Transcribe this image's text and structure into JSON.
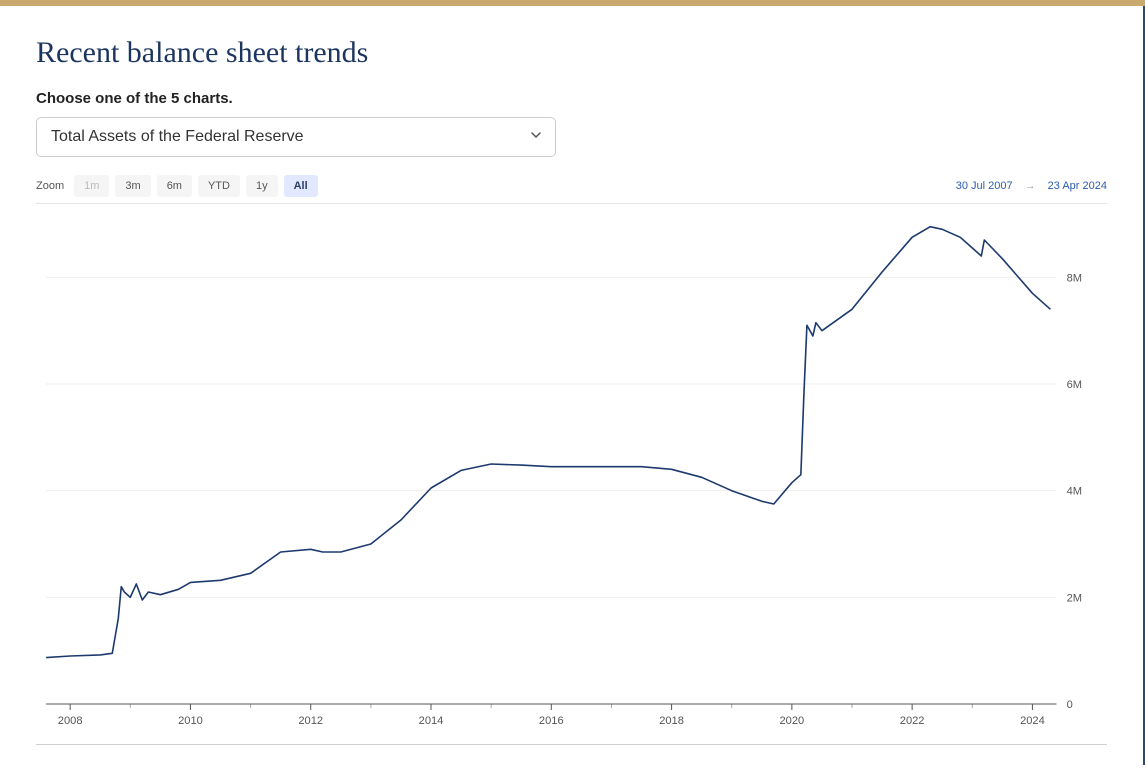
{
  "header": {
    "title": "Recent balance sheet trends",
    "prompt": "Choose one of the 5 charts."
  },
  "selector": {
    "value": "Total Assets of the Federal Reserve"
  },
  "zoom": {
    "label": "Zoom",
    "buttons": [
      "1m",
      "3m",
      "6m",
      "YTD",
      "1y",
      "All"
    ],
    "disabled": [
      "1m"
    ],
    "active": "All"
  },
  "range": {
    "from": "30 Jul 2007",
    "to": "23 Apr 2024",
    "arrow": "→"
  },
  "chart_data": {
    "type": "line",
    "x": [
      2007.6,
      2008.0,
      2008.5,
      2008.7,
      2008.8,
      2008.85,
      2008.9,
      2009.0,
      2009.1,
      2009.2,
      2009.3,
      2009.5,
      2009.8,
      2010.0,
      2010.5,
      2011.0,
      2011.5,
      2012.0,
      2012.2,
      2012.5,
      2013.0,
      2013.5,
      2014.0,
      2014.5,
      2015.0,
      2015.5,
      2016.0,
      2016.5,
      2017.0,
      2017.5,
      2018.0,
      2018.5,
      2019.0,
      2019.5,
      2019.7,
      2020.0,
      2020.15,
      2020.2,
      2020.25,
      2020.35,
      2020.4,
      2020.5,
      2021.0,
      2021.5,
      2022.0,
      2022.3,
      2022.5,
      2022.8,
      2023.0,
      2023.15,
      2023.2,
      2023.5,
      2024.0,
      2024.3
    ],
    "values": [
      870000,
      900000,
      920000,
      950000,
      1600000,
      2200000,
      2100000,
      2000000,
      2250000,
      1950000,
      2100000,
      2050000,
      2150000,
      2280000,
      2320000,
      2450000,
      2850000,
      2900000,
      2850000,
      2850000,
      3000000,
      3450000,
      4050000,
      4380000,
      4500000,
      4480000,
      4450000,
      4450000,
      4450000,
      4450000,
      4400000,
      4250000,
      4000000,
      3800000,
      3750000,
      4150000,
      4300000,
      5800000,
      7100000,
      6900000,
      7150000,
      7000000,
      7400000,
      8100000,
      8750000,
      8950000,
      8900000,
      8750000,
      8550000,
      8400000,
      8700000,
      8350000,
      7700000,
      7400000
    ],
    "xlabel": "",
    "ylabel": "",
    "xlim": [
      2007.6,
      2024.4
    ],
    "ylim": [
      0,
      9000000
    ],
    "yticks": [
      0,
      2000000,
      4000000,
      6000000,
      8000000
    ],
    "ytick_labels": [
      "0",
      "2M",
      "4M",
      "6M",
      "8M"
    ],
    "xticks": [
      2008,
      2010,
      2012,
      2014,
      2016,
      2018,
      2020,
      2022,
      2024
    ],
    "xtick_labels": [
      "2008",
      "2010",
      "2012",
      "2014",
      "2016",
      "2018",
      "2020",
      "2022",
      "2024"
    ]
  }
}
